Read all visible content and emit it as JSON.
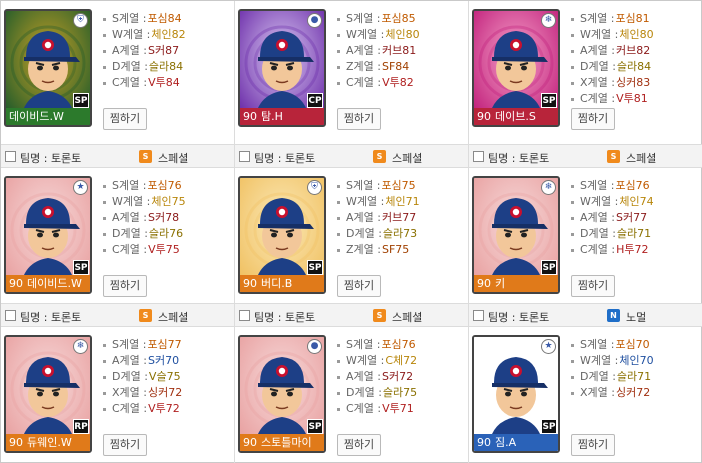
{
  "cards": [
    {
      "has_header": false,
      "name": "데이비드.W",
      "level": "",
      "position": "SP",
      "bg": "#1e5a2a",
      "bg2": "#c9a227",
      "namebar": "#2c7a2c",
      "grade_icon": "shield",
      "stats": [
        {
          "key": "S계열 :",
          "val": "포심84",
          "cls": "cat-s"
        },
        {
          "key": "W계열 :",
          "val": "체인82",
          "cls": "cat-w"
        },
        {
          "key": "A계열 :",
          "val": "S커87",
          "cls": "cat-a"
        },
        {
          "key": "D계열 :",
          "val": "슬라84",
          "cls": "cat-d"
        },
        {
          "key": "C계열 :",
          "val": "V투84",
          "cls": "cat-c"
        }
      ],
      "button": "찜하기"
    },
    {
      "has_header": false,
      "name": "탐.H",
      "level": "90",
      "position": "CP",
      "bg": "#6a2aa8",
      "bg2": "#d9c9f2",
      "namebar": "#b8243a",
      "grade_icon": "ball",
      "stats": [
        {
          "key": "S계열 :",
          "val": "포심85",
          "cls": "cat-s"
        },
        {
          "key": "W계열 :",
          "val": "체인80",
          "cls": "cat-w"
        },
        {
          "key": "A계열 :",
          "val": "커브81",
          "cls": "cat-a"
        },
        {
          "key": "Z계열 :",
          "val": "SF84",
          "cls": "cat-z"
        },
        {
          "key": "C계열 :",
          "val": "V투82",
          "cls": "cat-c"
        }
      ],
      "button": "찜하기"
    },
    {
      "has_header": false,
      "name": "데이브.S",
      "level": "90",
      "position": "SP",
      "bg": "#c01e7a",
      "bg2": "#f5a0c8",
      "namebar": "#b8243a",
      "grade_icon": "snow",
      "stats": [
        {
          "key": "S계열 :",
          "val": "포심81",
          "cls": "cat-s"
        },
        {
          "key": "W계열 :",
          "val": "체인80",
          "cls": "cat-w"
        },
        {
          "key": "A계열 :",
          "val": "커브82",
          "cls": "cat-a"
        },
        {
          "key": "D계열 :",
          "val": "슬라84",
          "cls": "cat-d"
        },
        {
          "key": "X계열 :",
          "val": "싱커83",
          "cls": "cat-x"
        },
        {
          "key": "C계열 :",
          "val": "V투81",
          "cls": "cat-c"
        }
      ],
      "button": "찜하기"
    },
    {
      "has_header": true,
      "team": "팀명 : 토론토",
      "type_label": "스페셜",
      "type_badge": "S",
      "badge_color": "#f08a1c",
      "name": "데이비드.W",
      "level": "90",
      "position": "SP",
      "bg": "#e8a0a0",
      "bg2": "#f7dada",
      "namebar": "#e07a1a",
      "grade_icon": "star",
      "stats": [
        {
          "key": "S계열 :",
          "val": "포심76",
          "cls": "cat-s"
        },
        {
          "key": "W계열 :",
          "val": "체인75",
          "cls": "cat-w"
        },
        {
          "key": "A계열 :",
          "val": "S커78",
          "cls": "cat-a"
        },
        {
          "key": "D계열 :",
          "val": "슬라76",
          "cls": "cat-d"
        },
        {
          "key": "C계열 :",
          "val": "V투75",
          "cls": "cat-c"
        }
      ],
      "button": "찜하기"
    },
    {
      "has_header": true,
      "team": "팀명 : 토론토",
      "type_label": "스페셜",
      "type_badge": "S",
      "badge_color": "#f08a1c",
      "name": "버디.B",
      "level": "90",
      "position": "SP",
      "bg": "#f0c060",
      "bg2": "#fbe9b8",
      "namebar": "#e07a1a",
      "grade_icon": "shield",
      "stats": [
        {
          "key": "S계열 :",
          "val": "포심75",
          "cls": "cat-s"
        },
        {
          "key": "W계열 :",
          "val": "체인71",
          "cls": "cat-w"
        },
        {
          "key": "A계열 :",
          "val": "커브77",
          "cls": "cat-a"
        },
        {
          "key": "D계열 :",
          "val": "슬라73",
          "cls": "cat-d"
        },
        {
          "key": "Z계열 :",
          "val": "SF75",
          "cls": "cat-z"
        }
      ],
      "button": "찜하기"
    },
    {
      "has_header": true,
      "team": "팀명 : 토론토",
      "type_label": "스페셜",
      "type_badge": "S",
      "badge_color": "#f08a1c",
      "name": "키",
      "level": "90",
      "position": "SP",
      "bg": "#e8a0a0",
      "bg2": "#f7dada",
      "namebar": "#e07a1a",
      "grade_icon": "snow",
      "stats": [
        {
          "key": "S계열 :",
          "val": "포심76",
          "cls": "cat-s"
        },
        {
          "key": "W계열 :",
          "val": "체인74",
          "cls": "cat-w"
        },
        {
          "key": "A계열 :",
          "val": "S커77",
          "cls": "cat-a"
        },
        {
          "key": "D계열 :",
          "val": "슬라71",
          "cls": "cat-d"
        },
        {
          "key": "C계열 :",
          "val": "H투72",
          "cls": "cat-c"
        }
      ],
      "button": "찜하기"
    },
    {
      "has_header": true,
      "team": "팀명 : 토론토",
      "type_label": "스페셜",
      "type_badge": "S",
      "badge_color": "#f08a1c",
      "name": "듀웨인.W",
      "level": "90",
      "position": "RP",
      "bg": "#e8a0a0",
      "bg2": "#f7dada",
      "namebar": "#e07a1a",
      "grade_icon": "snow",
      "stats": [
        {
          "key": "S계열 :",
          "val": "포심77",
          "cls": "cat-s"
        },
        {
          "key": "A계열 :",
          "val": "S커70",
          "cls": "cat-blue"
        },
        {
          "key": "D계열 :",
          "val": "V슬75",
          "cls": "cat-d"
        },
        {
          "key": "X계열 :",
          "val": "싱커72",
          "cls": "cat-x"
        },
        {
          "key": "C계열 :",
          "val": "V투72",
          "cls": "cat-c"
        }
      ],
      "button": "찜하기"
    },
    {
      "has_header": true,
      "team": "팀명 : 토론토",
      "type_label": "스페셜",
      "type_badge": "S",
      "badge_color": "#f08a1c",
      "name": "스토틀마이",
      "level": "90",
      "position": "SP",
      "bg": "#e8a0a0",
      "bg2": "#f7dada",
      "namebar": "#e07a1a",
      "grade_icon": "ball",
      "stats": [
        {
          "key": "S계열 :",
          "val": "포심76",
          "cls": "cat-s"
        },
        {
          "key": "W계열 :",
          "val": "C체72",
          "cls": "cat-w"
        },
        {
          "key": "A계열 :",
          "val": "S커72",
          "cls": "cat-a"
        },
        {
          "key": "D계열 :",
          "val": "슬라75",
          "cls": "cat-d"
        },
        {
          "key": "C계열 :",
          "val": "V투71",
          "cls": "cat-c"
        }
      ],
      "button": "찜하기"
    },
    {
      "has_header": true,
      "team": "팀명 : 토론토",
      "type_label": "노멀",
      "type_badge": "N",
      "badge_color": "#1f6ec8",
      "name": "짐.A",
      "level": "90",
      "position": "SP",
      "bg": "#ffffff",
      "bg2": "#ffffff",
      "namebar": "#2a62b8",
      "grade_icon": "star",
      "stats": [
        {
          "key": "S계열 :",
          "val": "포심70",
          "cls": "cat-s"
        },
        {
          "key": "W계열 :",
          "val": "체인70",
          "cls": "cat-blue"
        },
        {
          "key": "D계열 :",
          "val": "슬라71",
          "cls": "cat-d"
        },
        {
          "key": "X계열 :",
          "val": "싱커72",
          "cls": "cat-x"
        }
      ],
      "button": "찜하기"
    }
  ]
}
